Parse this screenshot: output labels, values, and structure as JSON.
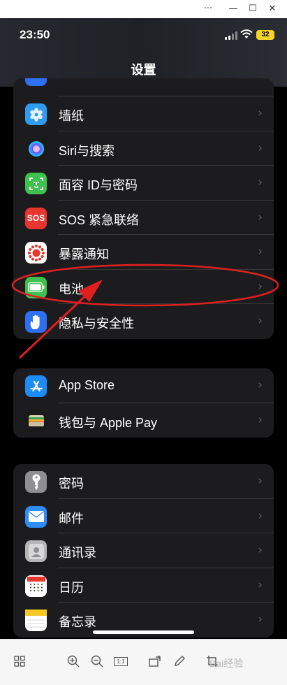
{
  "window": {
    "buttons": [
      "···",
      "—",
      "☐",
      "✕"
    ]
  },
  "status_bar": {
    "time": "23:50",
    "battery": "32"
  },
  "nav": {
    "title": "设置"
  },
  "groups": [
    {
      "items": [
        {
          "label": "墙纸",
          "icon": "wallpaper-icon",
          "color": "#2f9cf0"
        },
        {
          "label": "Siri与搜索",
          "icon": "siri-icon",
          "color": "#1a1a1a"
        },
        {
          "label": "面容 ID与密码",
          "icon": "face-id-icon",
          "color": "#3ec14f"
        },
        {
          "label": "SOS 紧急联络",
          "icon": "sos-icon",
          "color": "#e8362f"
        },
        {
          "label": "暴露通知",
          "icon": "exposure-notification-icon",
          "color": "#ffffff"
        },
        {
          "label": "电池",
          "icon": "battery-icon",
          "color": "#3ec14f"
        },
        {
          "label": "隐私与安全性",
          "icon": "privacy-hand-icon",
          "color": "#2f6ff2"
        }
      ]
    },
    {
      "items": [
        {
          "label": "App Store",
          "icon": "app-store-icon",
          "color": "#1e8cf6"
        },
        {
          "label": "钱包与 Apple Pay",
          "icon": "wallet-icon",
          "color": "#1a1a1a"
        }
      ]
    },
    {
      "items": [
        {
          "label": "密码",
          "icon": "key-icon",
          "color": "#8e8e93"
        },
        {
          "label": "邮件",
          "icon": "mail-icon",
          "color": "#2d8cf5"
        },
        {
          "label": "通讯录",
          "icon": "contacts-icon",
          "color": "#b5b5b5"
        },
        {
          "label": "日历",
          "icon": "calendar-icon",
          "color": "#ffffff"
        },
        {
          "label": "备忘录",
          "icon": "notes-icon",
          "color": "#ffffff"
        }
      ]
    }
  ],
  "toolbar": {
    "fit_label": "1:1",
    "watermark": "Bai经验"
  },
  "accent": {
    "annotation": "#e02020"
  }
}
